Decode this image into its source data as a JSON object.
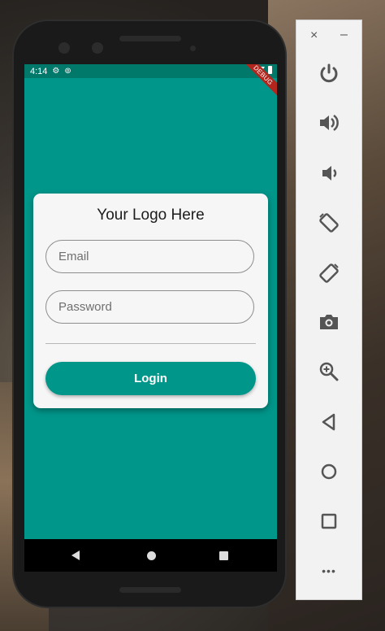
{
  "status_bar": {
    "time": "4:14",
    "debug_banner": "DEBUG"
  },
  "app": {
    "logo_text": "Your Logo Here",
    "email": {
      "placeholder": "Email",
      "value": ""
    },
    "password": {
      "placeholder": "Password",
      "value": ""
    },
    "login_label": "Login"
  },
  "emulator_panel": {
    "close_label": "×",
    "minimize_label": "–",
    "more_label": "•••",
    "tools": [
      "power-icon",
      "volume-up-icon",
      "volume-down-icon",
      "rotate-left-icon",
      "rotate-right-icon",
      "camera-icon",
      "zoom-icon",
      "back-icon",
      "home-icon",
      "overview-icon",
      "more-icon"
    ]
  },
  "colors": {
    "primary": "#00968a",
    "status_bar": "#00796b",
    "card": "#f6f6f6"
  }
}
